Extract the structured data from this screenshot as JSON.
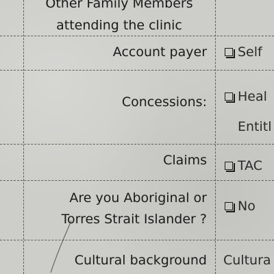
{
  "rows": {
    "family_members": {
      "label_line1": "Other  Family Members",
      "label_line2": "attending the clinic"
    },
    "account_payer": {
      "label": "Account payer",
      "option": "Self"
    },
    "concessions": {
      "label": "Concessions:",
      "option": "Heal",
      "sub_text": "Entitl"
    },
    "claims": {
      "label": "Claims",
      "option": "TAC"
    },
    "aboriginal": {
      "label_line1": "Are you Aboriginal or",
      "label_line2": "Torres Strait Islander ?",
      "option": "No"
    },
    "cultural_background": {
      "label": "Cultural background",
      "value": "Cultura"
    }
  }
}
